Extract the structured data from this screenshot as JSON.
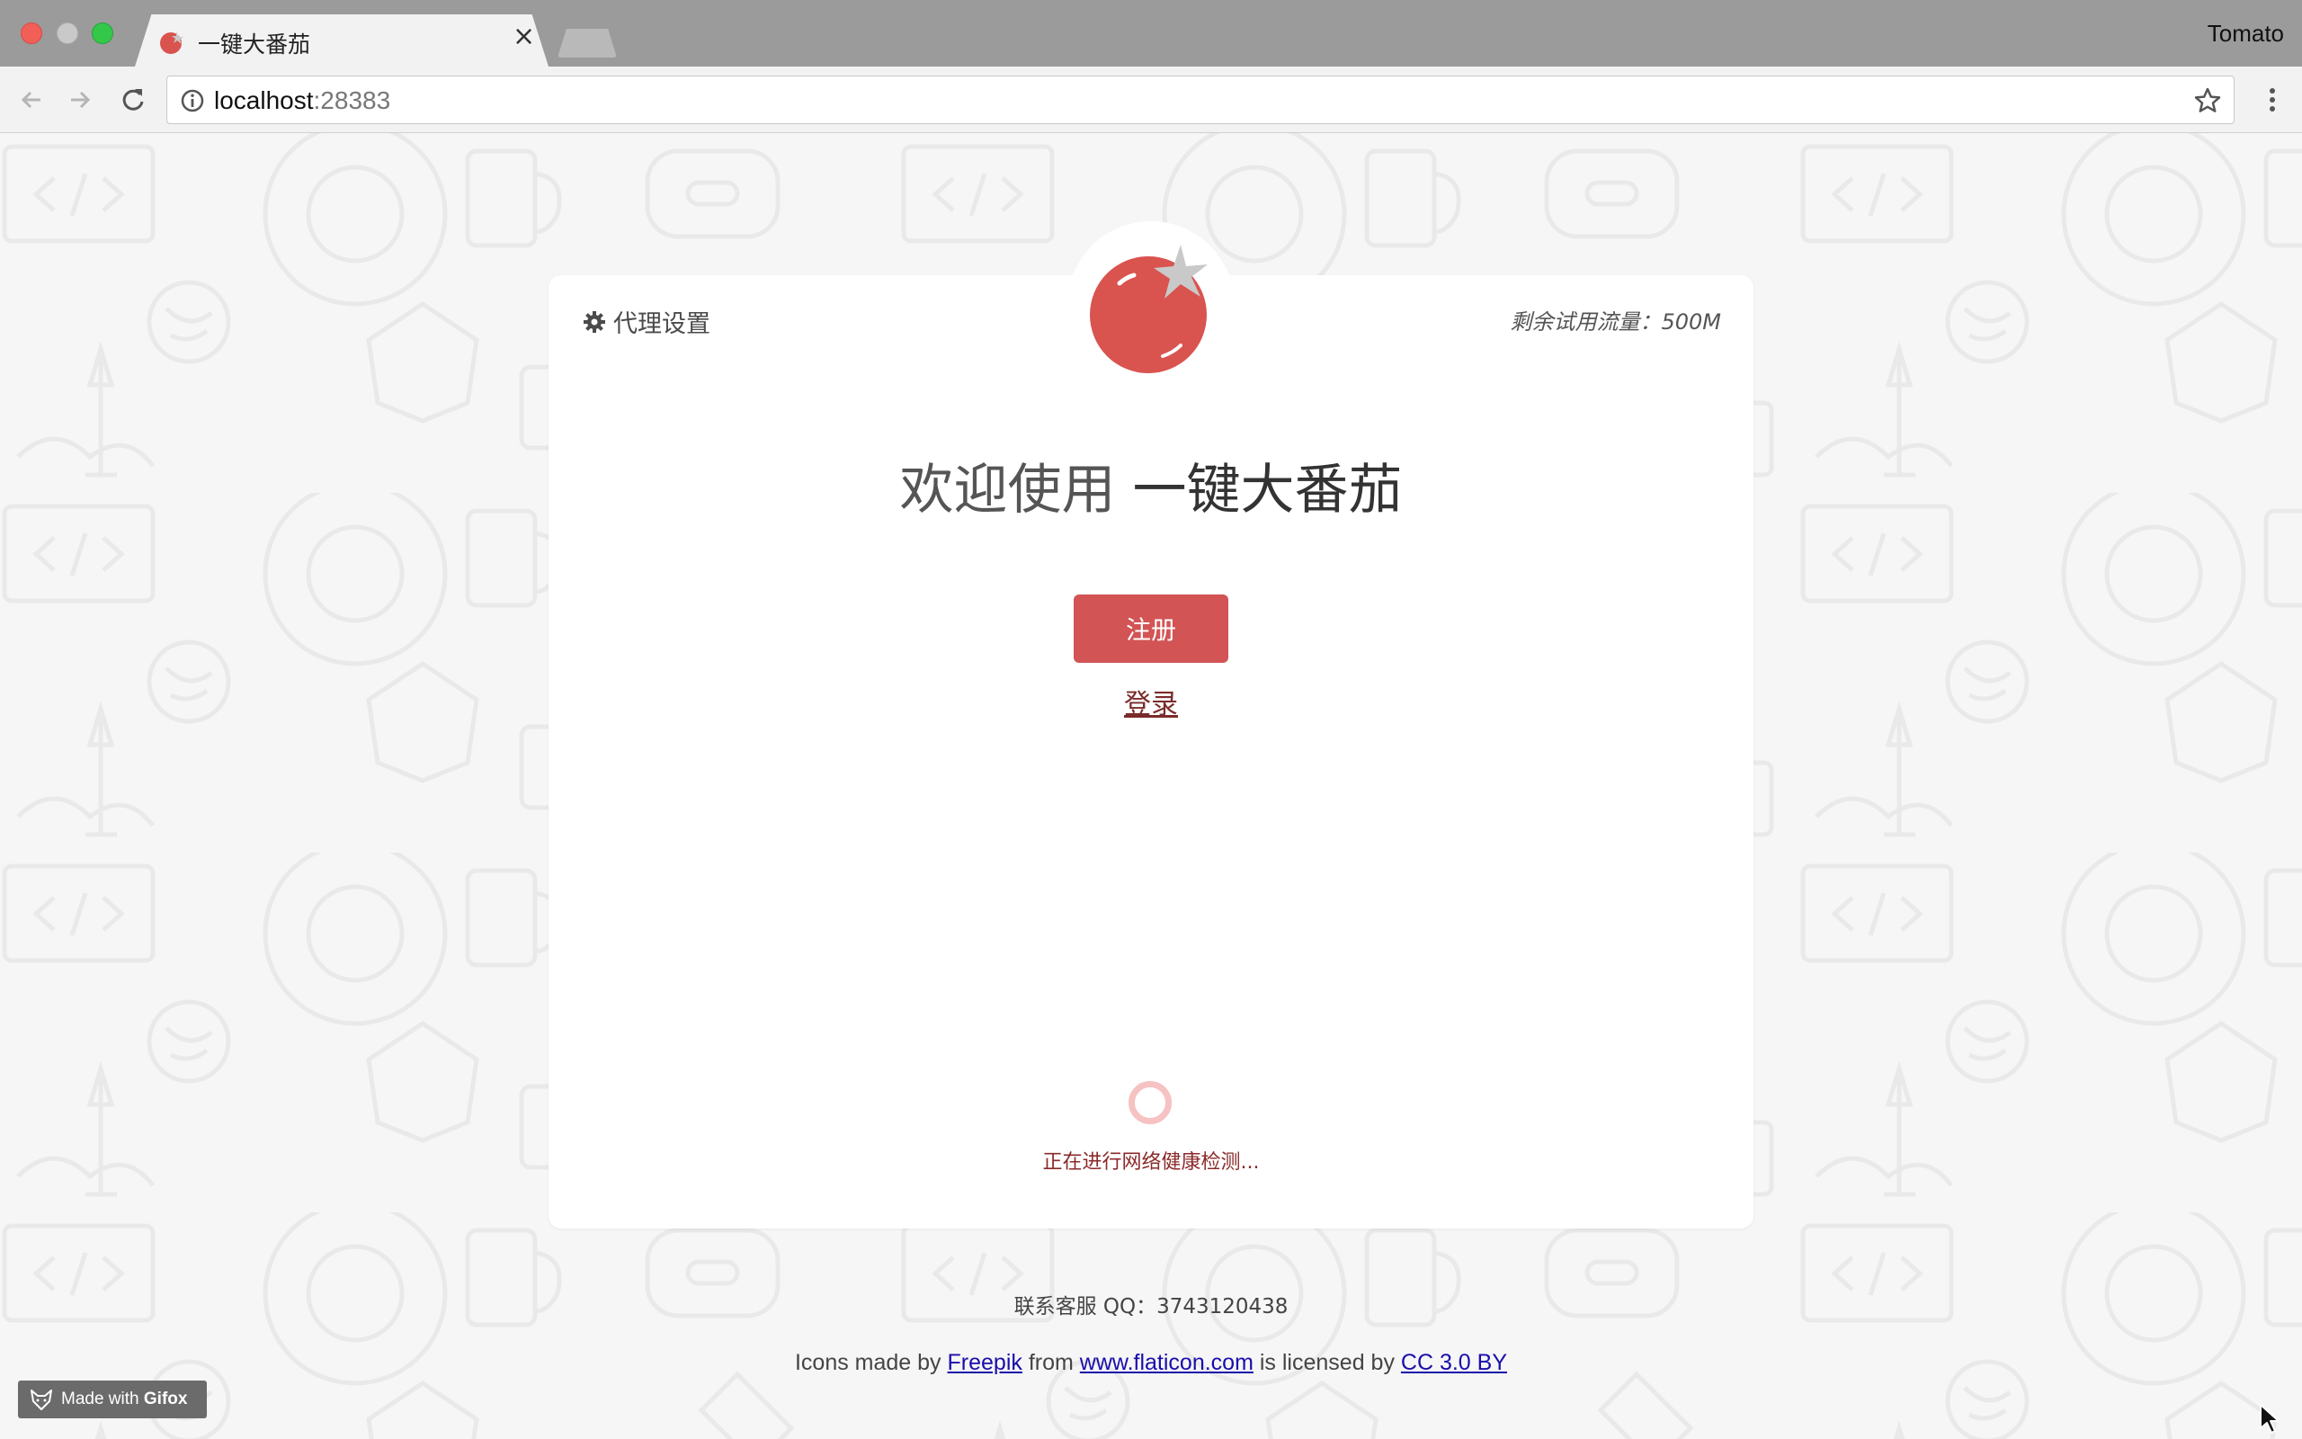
{
  "browser": {
    "tab_title": "一键大番茄",
    "tab_close": "×",
    "profile_name": "Tomato",
    "url_host": "localhost",
    "url_port": ":28383"
  },
  "card": {
    "proxy_label": "代理设置",
    "quota_text": "剩余试用流量：500M",
    "welcome_prefix": "欢迎使用",
    "welcome_brand": "一键大番茄",
    "register_label": "注册",
    "login_label": "登录",
    "status_text": "正在进行网络健康检测..."
  },
  "footer": {
    "contact": "联系客服 QQ：3743120438",
    "credit_prefix": "Icons made by",
    "credit_author": "Freepik",
    "credit_from": "from",
    "credit_site": "www.flaticon.com",
    "credit_licensed": "is licensed by",
    "credit_license": "CC 3.0 BY"
  },
  "gifox": {
    "made_with": "Made with",
    "brand": "Gifox"
  },
  "colors": {
    "accent": "#d25455",
    "tomato": "#d9534f",
    "link": "#1a0dab"
  }
}
